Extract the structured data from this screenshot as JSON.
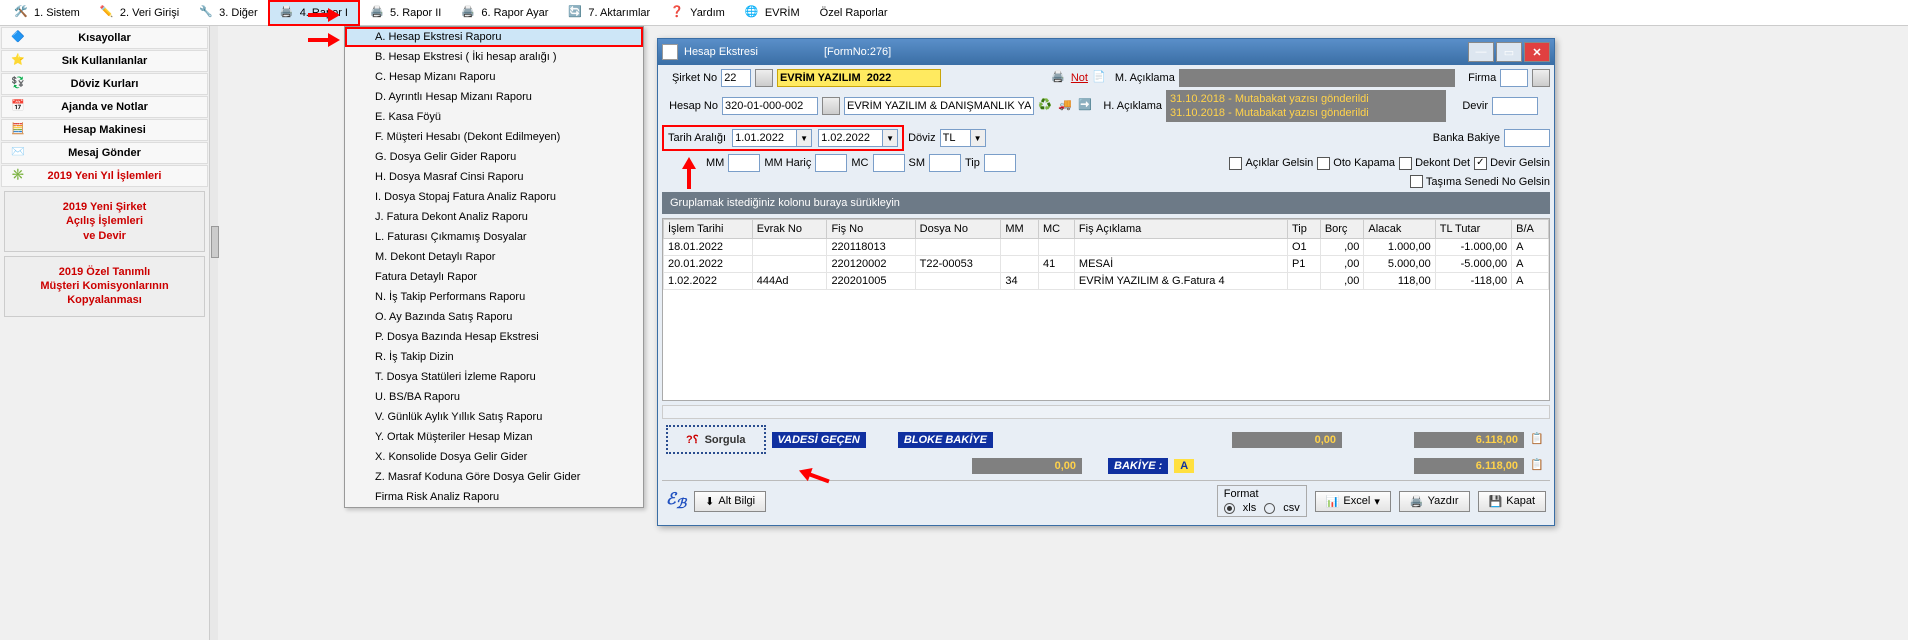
{
  "menubar": [
    {
      "label": "1.   Sistem"
    },
    {
      "label": "2.   Veri Girişi"
    },
    {
      "label": "3.   Diğer"
    },
    {
      "label": "4.   Rapor I",
      "hl": true
    },
    {
      "label": "5.   Rapor II"
    },
    {
      "label": "6.   Rapor Ayar"
    },
    {
      "label": "7.   Aktarımlar"
    },
    {
      "label": "Yardım"
    },
    {
      "label": "EVRİM"
    },
    {
      "label": "Özel Raporlar"
    }
  ],
  "sidebar": {
    "items": [
      {
        "label": "Kısayollar"
      },
      {
        "label": "Sık Kullanılanlar"
      },
      {
        "label": "Döviz Kurları"
      },
      {
        "label": "Ajanda ve Notlar"
      },
      {
        "label": "Hesap Makinesi"
      },
      {
        "label": "Mesaj Gönder"
      },
      {
        "label": "2019 Yeni Yıl İşlemleri",
        "red": true
      }
    ],
    "box1": "2019 Yeni Şirket\nAçılış İşlemleri\nve Devir",
    "box2": "2019 Özel Tanımlı\nMüşteri Komisyonlarının\nKopyalanması"
  },
  "dropdown": [
    {
      "label": "A.   Hesap Ekstresi Raporu",
      "hl": true
    },
    {
      "label": "B.   Hesap Ekstresi ( İki hesap aralığı )"
    },
    {
      "label": "C.   Hesap Mizanı Raporu"
    },
    {
      "label": "D.   Ayrıntlı Hesap Mizanı Raporu"
    },
    {
      "label": "E.   Kasa Föyü"
    },
    {
      "label": "F.   Müşteri Hesabı (Dekont Edilmeyen)"
    },
    {
      "label": "G.   Dosya Gelir Gider Raporu"
    },
    {
      "label": "H.   Dosya Masraf Cinsi Raporu"
    },
    {
      "label": "I.   Dosya Stopaj Fatura Analiz Raporu"
    },
    {
      "label": "J.   Fatura Dekont Analiz Raporu"
    },
    {
      "label": "L.   Faturası Çıkmamış Dosyalar"
    },
    {
      "label": "M.   Dekont Detaylı Rapor"
    },
    {
      "label": "      Fatura Detaylı Rapor"
    },
    {
      "label": "N.   İş Takip Performans Raporu"
    },
    {
      "label": "O.   Ay Bazında Satış Raporu"
    },
    {
      "label": "P.   Dosya Bazında Hesap Ekstresi"
    },
    {
      "label": "R.   İş Takip Dizin"
    },
    {
      "label": "T.   Dosya Statüleri İzleme Raporu"
    },
    {
      "label": "U.   BS/BA Raporu"
    },
    {
      "label": "V.   Günlük Aylık Yıllık Satış Raporu"
    },
    {
      "label": "Y.  Ortak Müşteriler Hesap Mizan"
    },
    {
      "label": "X.  Konsolide Dosya Gelir Gider"
    },
    {
      "label": "Z.  Masraf Koduna Göre Dosya Gelir Gider"
    },
    {
      "label": "     Firma Risk Analiz Raporu"
    }
  ],
  "modal": {
    "title": "Hesap Ekstresi",
    "formno": "[FormNo:276]",
    "sirket_lbl": "Şirket No",
    "sirket_val": "22",
    "sirket_name": "EVRİM YAZILIM  2022",
    "hesap_lbl": "Hesap No",
    "hesap_val": "320-01-000-002",
    "hesap_name": "EVRİM YAZILIM & DANIŞMANLIK YA",
    "not": "Not",
    "m_aciklama": "M. Açıklama",
    "h_aciklama": "H. Açıklama",
    "note1": "31.10.2018 - Mutabakat yazısı gönderildi",
    "note2": "31.10.2018 - Mutabakat yazısı gönderildi",
    "firma": "Firma",
    "devir": "Devir",
    "banka": "Banka Bakiye",
    "tarih_lbl": "Tarih Aralığı",
    "d1": "1.01.2022",
    "d2": "1.02.2022",
    "doviz_lbl": "Döviz",
    "doviz_val": "TL",
    "mm": "MM",
    "mmharic": "MM Hariç",
    "mc": "MC",
    "sm": "SM",
    "tip": "Tip",
    "chk_aciklar": "Açıklar Gelsin",
    "chk_oto": "Oto Kapama",
    "chk_dekont": "Dekont Det",
    "chk_devir": "Devir Gelsin",
    "chk_tasima": "Taşıma Senedi No Gelsin",
    "group_hdr": "Gruplamak istediğiniz kolonu buraya sürükleyin",
    "cols": [
      "İşlem Tarihi",
      "Evrak No",
      "Fiş No",
      "Dosya No",
      "MM",
      "MC",
      "Fiş Açıklama",
      "Tip",
      "Borç",
      "Alacak",
      "TL Tutar",
      "B/A"
    ],
    "rows": [
      {
        "tarih": "18.01.2022",
        "evrak": "",
        "fis": "220118013",
        "dosya": "",
        "mm": "",
        "mc": "",
        "acik": "",
        "tip": "O1",
        "borc": ",00",
        "alacak": "1.000,00",
        "tl": "-1.000,00",
        "ba": "A"
      },
      {
        "tarih": "20.01.2022",
        "evrak": "",
        "fis": "220120002",
        "dosya": "T22-00053",
        "mm": "",
        "mc": "41",
        "acik": "MESAİ",
        "tip": "P1",
        "borc": ",00",
        "alacak": "5.000,00",
        "tl": "-5.000,00",
        "ba": "A"
      },
      {
        "tarih": "1.02.2022",
        "evrak": "444Ad",
        "fis": "220201005",
        "dosya": "",
        "mm": "34",
        "mc": "",
        "acik": "EVRİM YAZILIM & G.Fatura 4",
        "tip": "",
        "borc": ",00",
        "alacak": "118,00",
        "tl": "-118,00",
        "ba": "A"
      }
    ],
    "sorgula": "Sorgula",
    "vadesi": "VADESİ GEÇEN",
    "bloke": "BLOKE BAKİYE",
    "bakiye": "BAKİYE      :",
    "amt1": "0,00",
    "amt2": "0,00",
    "amt3": "6.118,00",
    "amt4": "6.118,00",
    "aletter": "A",
    "altbilgi": "Alt Bilgi",
    "format": "Format",
    "xls": "xls",
    "csv": "csv",
    "excel": "Excel",
    "yazdir": "Yazdır",
    "kapat": "Kapat"
  }
}
